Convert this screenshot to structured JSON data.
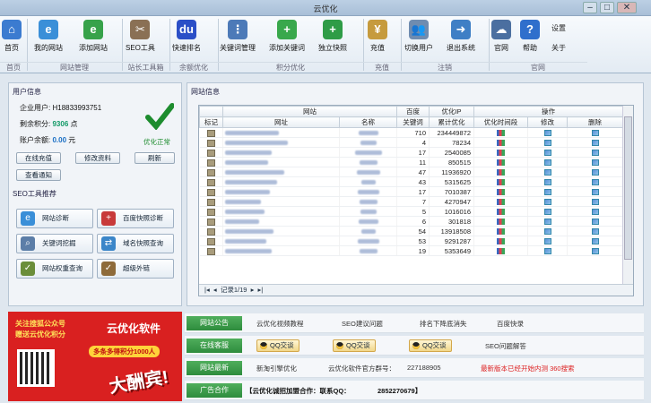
{
  "window": {
    "title": "云优化",
    "min": "–",
    "max": "□",
    "close": "✕"
  },
  "ribbon": {
    "buttons": [
      {
        "label": "首页",
        "icon": "⌂",
        "color": "#3b7bd0",
        "name": "home"
      },
      {
        "label": "我的网站",
        "icon": "e",
        "color": "#3a8fd8",
        "name": "my-sites"
      },
      {
        "label": "添加网站",
        "icon": "e",
        "color": "#37a24a",
        "name": "add-site"
      },
      {
        "label": "SEO工具",
        "icon": "✂",
        "color": "#8a7055",
        "name": "seo-tools"
      },
      {
        "label": "快速排名",
        "icon": "du",
        "color": "#2b4fc7",
        "name": "quick-rank"
      },
      {
        "label": "关键词管理",
        "icon": "⋮",
        "color": "#4d7ab8",
        "name": "keyword-manage"
      },
      {
        "label": "添加关键词",
        "icon": "+",
        "color": "#39a84c",
        "name": "add-keyword"
      },
      {
        "label": "独立快照",
        "icon": "+",
        "color": "#2f9c47",
        "name": "snapshot"
      },
      {
        "label": "充值",
        "icon": "¥",
        "color": "#c69b3e",
        "name": "recharge"
      },
      {
        "label": "切换用户",
        "icon": "👥",
        "color": "#6f8cb0",
        "name": "switch-user"
      },
      {
        "label": "退出系统",
        "icon": "➜",
        "color": "#3f7fc5",
        "name": "exit"
      },
      {
        "label": "官网",
        "icon": "☁",
        "color": "#4b6fa0",
        "name": "official-site"
      },
      {
        "label": "帮助",
        "icon": "?",
        "color": "#2f6fcc",
        "name": "help"
      }
    ],
    "settings": "设置",
    "about": "关于",
    "groups": [
      "首页",
      "网站管理",
      "站长工具箱",
      "余额优化",
      "积分优化",
      "充值",
      "注销",
      "官网"
    ]
  },
  "user": {
    "section": "用户信息",
    "account_label": "企业用户:",
    "account": "H18833993751",
    "points_label": "剩余积分:",
    "points": "9306",
    "points_unit": "点",
    "balance_label": "账户余额:",
    "balance": "0.00",
    "balance_unit": "元",
    "status": "优化正常",
    "btn_recharge": "在线充值",
    "btn_edit": "修改资料",
    "btn_refresh": "刷新",
    "btn_notice": "查看通知"
  },
  "seo": {
    "section": "SEO工具推荐",
    "tools": [
      {
        "label": "网站诊断",
        "icon": "e",
        "color": "#3a8fd8",
        "name": "site-diagnose"
      },
      {
        "label": "百度快照诊断",
        "icon": "+",
        "color": "#c83a3a",
        "name": "snapshot-diagnose"
      },
      {
        "label": "关键词挖掘",
        "icon": "⌕",
        "color": "#5c7ea8",
        "name": "keyword-mining"
      },
      {
        "label": "域名快照查询",
        "icon": "⇄",
        "color": "#3b86c9",
        "name": "snapshot-query"
      },
      {
        "label": "网站权重查询",
        "icon": "✓",
        "color": "#6b8e3a",
        "name": "weight-query"
      },
      {
        "label": "超级外链",
        "icon": "✓",
        "color": "#8e6b3a",
        "name": "super-links"
      }
    ]
  },
  "sites": {
    "section": "网站信息",
    "group_site": "网站",
    "group_baidu": "百度",
    "group_opt": "优化IP",
    "group_ops": "操作",
    "columns": [
      "标记",
      "网址",
      "名称",
      "关键词",
      "累计优化",
      "优化时间段",
      "修改",
      "删除"
    ],
    "rows": [
      {
        "kw": "710",
        "cum": "234449872"
      },
      {
        "kw": "4",
        "cum": "78234"
      },
      {
        "kw": "17",
        "cum": "2540085"
      },
      {
        "kw": "11",
        "cum": "850515"
      },
      {
        "kw": "47",
        "cum": "11936920"
      },
      {
        "kw": "43",
        "cum": "5315625"
      },
      {
        "kw": "17",
        "cum": "7010387"
      },
      {
        "kw": "7",
        "cum": "4270947"
      },
      {
        "kw": "5",
        "cum": "1016016"
      },
      {
        "kw": "6",
        "cum": "301818"
      },
      {
        "kw": "54",
        "cum": "13918508"
      },
      {
        "kw": "53",
        "cum": "9291287"
      },
      {
        "kw": "19",
        "cum": "5353649"
      }
    ],
    "pager": "记录1/19"
  },
  "ad": {
    "line1": "关注搜狐公众号",
    "line2": "赠送云优化积分",
    "brand": "云优化软件",
    "banner": "多条多得积分1000人",
    "slogan": "大酬宾!"
  },
  "bottom": {
    "rows": [
      {
        "tag": "网站公告",
        "items": [
          "云优化视频教程",
          "SEO建议问题",
          "排名下降底消失",
          "百度快录"
        ]
      },
      {
        "tag": "在线客服",
        "items": [
          "QQ交谈",
          "QQ交谈",
          "QQ交谈",
          "SEO问题解答"
        ]
      },
      {
        "tag": "网站最新",
        "items": [
          "新淘引擎优化",
          "云优化软件官方群号：",
          "227188905",
          "最新版本已经开始内测 360搜索"
        ]
      },
      {
        "tag": "广告合作",
        "items": [
          "【云优化诚招加盟合作：联系QQ：",
          "2852270679】"
        ]
      }
    ]
  },
  "colors": {
    "green": "#2e8c3d",
    "red": "#d92020",
    "accent": "#3b7bd0"
  }
}
